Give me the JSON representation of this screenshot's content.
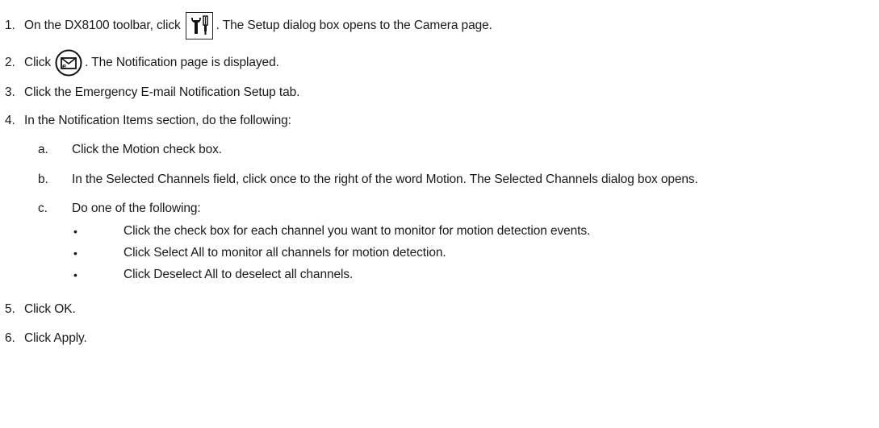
{
  "steps": {
    "s1": {
      "num": "1.",
      "before": "On the DX8100 toolbar, click",
      "after": ". The Setup dialog box opens to the Camera page.",
      "icon": "setup-tools-icon"
    },
    "s2": {
      "num": "2.",
      "before": "Click",
      "after": ". The Notification page is displayed.",
      "icon": "email-notification-icon"
    },
    "s3": {
      "num": "3.",
      "text": "Click the Emergency E-mail Notification Setup tab."
    },
    "s4": {
      "num": "4.",
      "text": "In the Notification Items section, do the following:"
    },
    "s5": {
      "num": "5.",
      "text": "Click OK."
    },
    "s6": {
      "num": "6.",
      "text": "Click Apply."
    }
  },
  "substeps": {
    "a": {
      "num": "a.",
      "text": "Click the Motion check box."
    },
    "b": {
      "num": "b.",
      "text": "In the Selected Channels field, click once to the right of the word Motion. The Selected Channels dialog box opens."
    },
    "c": {
      "num": "c.",
      "text": "Do one of the following:"
    }
  },
  "bullets": {
    "marker": "•",
    "items": [
      "Click the check box for each channel you want to monitor for motion detection events.",
      "Click Select All to monitor all channels for motion detection.",
      "Click Deselect All to deselect all channels."
    ]
  }
}
